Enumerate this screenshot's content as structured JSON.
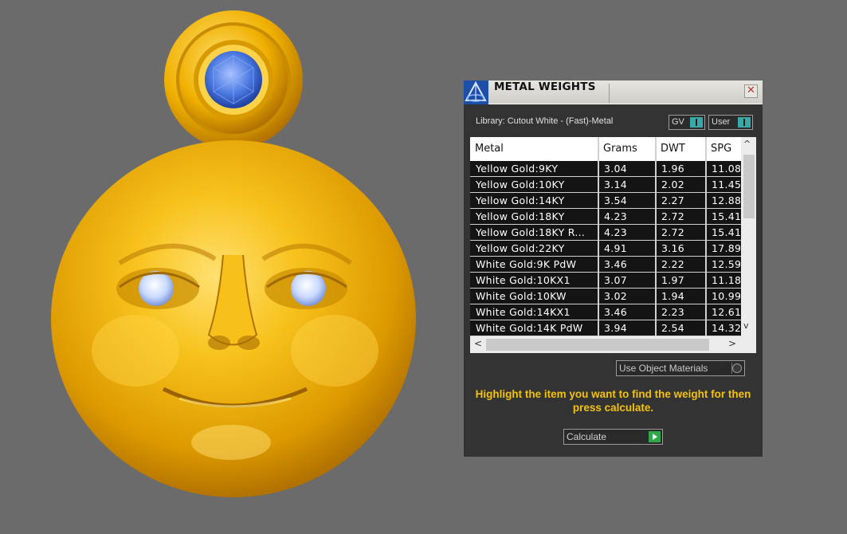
{
  "viewport": {
    "model": "gold moon face pendant with blue gemstone bail and diamond eyes"
  },
  "dialog": {
    "title": "METAL WEIGHTS",
    "close_label": "✕",
    "library_label": "Library: Cutout White - (Fast)-Metal",
    "toggles": {
      "gv_label": "GV",
      "user_label": "User"
    },
    "table": {
      "columns": [
        "Metal",
        "Grams",
        "DWT",
        "SPG"
      ],
      "rows": [
        [
          "Yellow Gold:9KY",
          "3.04",
          "1.96",
          "11.08"
        ],
        [
          "Yellow Gold:10KY",
          "3.14",
          "2.02",
          "11.45"
        ],
        [
          "Yellow Gold:14KY",
          "3.54",
          "2.27",
          "12.88"
        ],
        [
          "Yellow Gold:18KY",
          "4.23",
          "2.72",
          "15.41"
        ],
        [
          "Yellow Gold:18KY R...",
          "4.23",
          "2.72",
          "15.41"
        ],
        [
          "Yellow Gold:22KY",
          "4.91",
          "3.16",
          "17.89"
        ],
        [
          "White Gold:9K PdW",
          "3.46",
          "2.22",
          "12.59"
        ],
        [
          "White Gold:10KX1",
          "3.07",
          "1.97",
          "11.18"
        ],
        [
          "White Gold:10KW",
          "3.02",
          "1.94",
          "10.99"
        ],
        [
          "White Gold:14KX1",
          "3.46",
          "2.23",
          "12.61"
        ],
        [
          "White Gold:14K PdW",
          "3.94",
          "2.54",
          "14.32"
        ]
      ],
      "scroll_up": "^",
      "scroll_down": "v",
      "scroll_left": "<",
      "scroll_right": ">"
    },
    "use_object_materials_label": "Use Object Materials",
    "instructions": "Highlight the item you want to find the weight for then press calculate.",
    "calculate_label": "Calculate"
  },
  "colors": {
    "background": "#6b6b6b",
    "panel": "#333333",
    "instruction_text": "#f3c20d",
    "toggle_accent": "#3aa8a8",
    "calculate_accent": "#2fa84a",
    "gold": "#f2b20a",
    "gem_blue": "#3f6ed8"
  }
}
